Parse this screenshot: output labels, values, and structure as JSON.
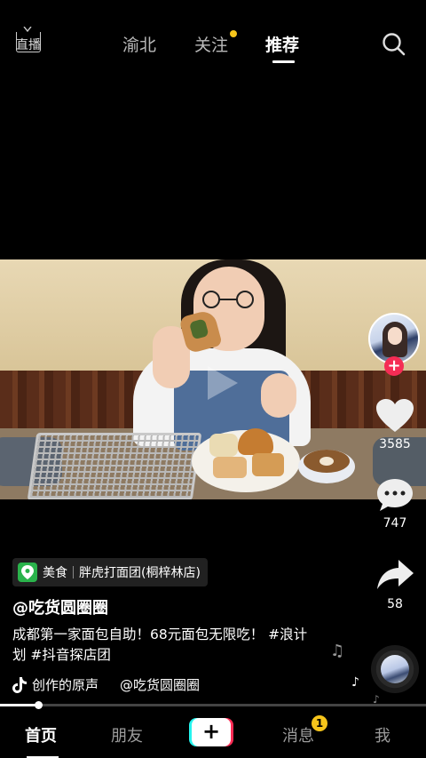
{
  "top_bar": {
    "live_label": "直播",
    "tabs": [
      {
        "label": "渝北",
        "active": false
      },
      {
        "label": "关注",
        "active": false,
        "has_dot": true
      },
      {
        "label": "推荐",
        "active": true
      }
    ],
    "search_icon": "search-icon"
  },
  "right_rail": {
    "follow_icon": "plus-icon",
    "likes": "3585",
    "comments": "747",
    "shares": "58"
  },
  "poi": {
    "category": "美食",
    "place": "胖虎打面团(桐梓林店)"
  },
  "author": "@吃货圆圈圈",
  "caption": "成都第一家面包自助！68元面包无限吃！ #浪计划 #抖音探店团",
  "music": {
    "name": "创作的原声",
    "by": "@吃货圆圈圈"
  },
  "progress": 0.09,
  "bottom_nav": {
    "home": "首页",
    "friends": "朋友",
    "add": "+",
    "messages": "消息",
    "messages_badge": "1",
    "me": "我"
  },
  "colors": {
    "accent": "#fe2c55",
    "badge": "#f6c51b",
    "poi": "#2ab34b"
  }
}
